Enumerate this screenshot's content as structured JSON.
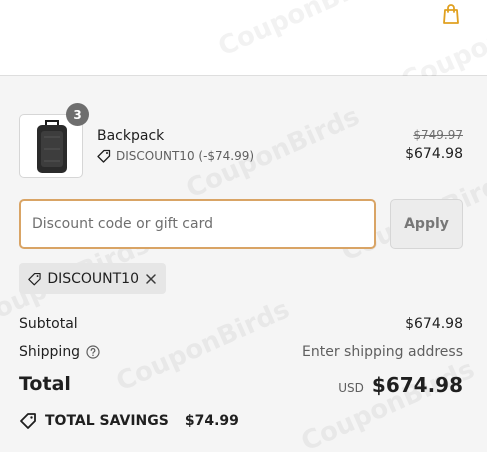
{
  "header": {
    "cart_icon": "shopping-bag-icon"
  },
  "watermark": {
    "text": "CouponBirds"
  },
  "line_item": {
    "quantity": "3",
    "name": "Backpack",
    "discount_text": "DISCOUNT10 (-$74.99)",
    "original_price": "$749.97",
    "price": "$674.98",
    "image_icon": "backpack-image"
  },
  "discount_form": {
    "placeholder": "Discount code or gift card",
    "value": "",
    "apply_label": "Apply"
  },
  "applied_code": {
    "code": "DISCOUNT10",
    "icon": "tag-icon",
    "remove_icon": "close-icon"
  },
  "totals": {
    "subtotal_label": "Subtotal",
    "subtotal_value": "$674.98",
    "shipping_label": "Shipping",
    "shipping_value": "Enter shipping address",
    "total_label": "Total",
    "currency": "USD",
    "total_value": "$674.98"
  },
  "savings": {
    "label": "TOTAL SAVINGS",
    "amount": "$74.99"
  },
  "colors": {
    "accent_border": "#d9a465",
    "bag_icon": "#e0a020",
    "summary_bg": "#f5f5f5"
  }
}
